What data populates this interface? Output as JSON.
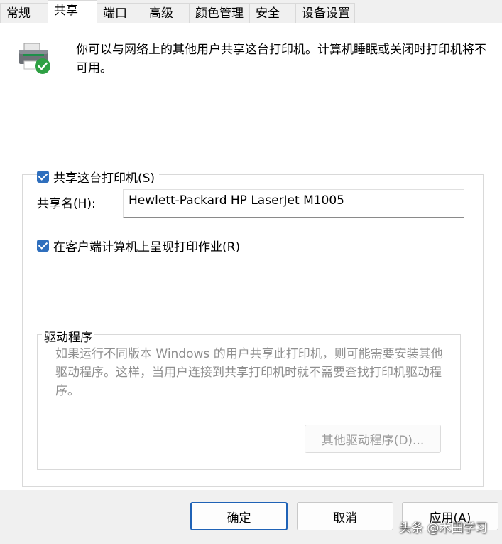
{
  "tabs": [
    {
      "label": "常规"
    },
    {
      "label": "共享"
    },
    {
      "label": "端口"
    },
    {
      "label": "高级"
    },
    {
      "label": "颜色管理"
    },
    {
      "label": "安全"
    },
    {
      "label": "设备设置"
    }
  ],
  "description": "你可以与网络上的其他用户共享这台打印机。计算机睡眠或关闭时打印机将不可用。",
  "share_printer": {
    "label": "共享这台打印机(S)",
    "checked": true
  },
  "share_name": {
    "label": "共享名(H):",
    "value": "Hewlett-Packard HP LaserJet M1005"
  },
  "render_jobs": {
    "label": "在客户端计算机上呈现打印作业(R)",
    "checked": true
  },
  "drivers": {
    "title": "驱动程序",
    "description": "如果运行不同版本 Windows 的用户共享此打印机，则可能需要安装其他驱动程序。这样，当用户连接到共享打印机时就不需要查找打印机驱动程序。",
    "button": "其他驱动程序(D)..."
  },
  "buttons": {
    "ok": "确定",
    "cancel": "取消",
    "apply": "应用(A)"
  },
  "watermark": "头条 @木田学习",
  "icons": {
    "printer": "printer-shared-icon",
    "check": "checkbox-check-icon"
  },
  "colors": {
    "accent": "#2f6fbd",
    "share_badge": "#2ea043"
  }
}
